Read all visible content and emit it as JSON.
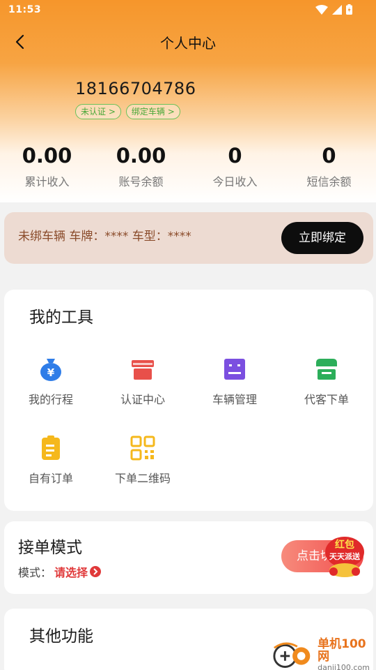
{
  "status_bar": {
    "time": "11:53"
  },
  "header": {
    "title": "个人中心"
  },
  "profile": {
    "phone": "18166704786",
    "tags": [
      "未认证 >",
      "绑定车辆 >"
    ]
  },
  "stats": [
    {
      "value": "0.00",
      "label": "累计收入"
    },
    {
      "value": "0.00",
      "label": "账号余额"
    },
    {
      "value": "0",
      "label": "今日收入"
    },
    {
      "value": "0",
      "label": "短信余额"
    }
  ],
  "vehicle_bind": {
    "text": "未绑车辆 车牌：**** 车型：****",
    "button_label": "立即绑定"
  },
  "tools": {
    "title": "我的工具",
    "items": [
      {
        "label": "我的行程",
        "icon": "money-bag-icon",
        "color": "#2f7de8"
      },
      {
        "label": "认证中心",
        "icon": "gift-box-icon",
        "color": "#e8504a"
      },
      {
        "label": "车辆管理",
        "icon": "list-box-icon",
        "color": "#7b4fe0"
      },
      {
        "label": "代客下单",
        "icon": "store-icon",
        "color": "#2cae5a"
      },
      {
        "label": "自有订单",
        "icon": "clipboard-icon",
        "color": "#f5b81c"
      },
      {
        "label": "下单二维码",
        "icon": "qr-code-icon",
        "color": "#f5b81c"
      }
    ]
  },
  "order_mode": {
    "title": "接单模式",
    "mode_label": "模式：",
    "mode_value": "请选择",
    "switch_label": "点击切换"
  },
  "promo": {
    "line1": "红包",
    "line2": "天天派送"
  },
  "other": {
    "title": "其他功能"
  },
  "watermark": {
    "name": "单机100网",
    "url": "danji100.com"
  }
}
